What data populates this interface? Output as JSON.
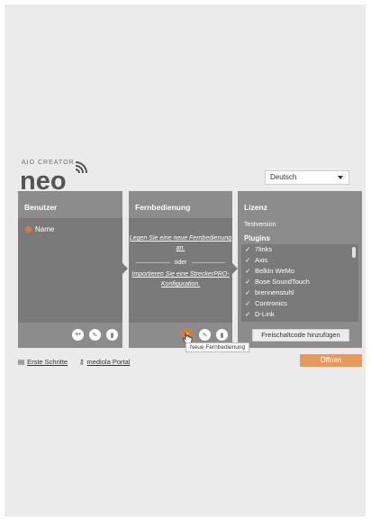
{
  "header": {
    "logo_subtitle": "AIO CREATOR",
    "logo_text": "neo",
    "language": {
      "selected": "Deutsch"
    }
  },
  "panels": {
    "benutzer": {
      "title": "Benutzer",
      "items": [
        {
          "label": "Name"
        }
      ],
      "actions": [
        "add-user-icon",
        "edit-icon",
        "delete-icon"
      ]
    },
    "fernbedienung": {
      "title": "Fernbedienung",
      "new_link": "Legen Sie eine neue Fernbedienung an.",
      "or_label": "oder",
      "import_link": "Importieren Sie eine StreckerPRO-Konfiguration.",
      "actions": [
        "add-icon",
        "edit-icon",
        "delete-icon"
      ],
      "tooltip": "Neue Fernbedienung"
    },
    "lizenz": {
      "title": "Lizenz",
      "subtitle": "Testversion",
      "plugins_title": "Plugins",
      "plugins": [
        "7links",
        "Axis",
        "Belkin WeMo",
        "Bose SoundTouch",
        "brennenstuhl",
        "Contronics",
        "D-Link"
      ],
      "activation_button": "Freischaltcode hinzufügen"
    }
  },
  "footer": {
    "first_steps": "Erste Schritte",
    "portal": "mediola Portal",
    "open_button": "Öffnen"
  },
  "colors": {
    "accent": "#e07a2b",
    "panel_header": "#8c8c8c",
    "panel_body": "#7a7a7a",
    "background": "#ebebeb"
  }
}
